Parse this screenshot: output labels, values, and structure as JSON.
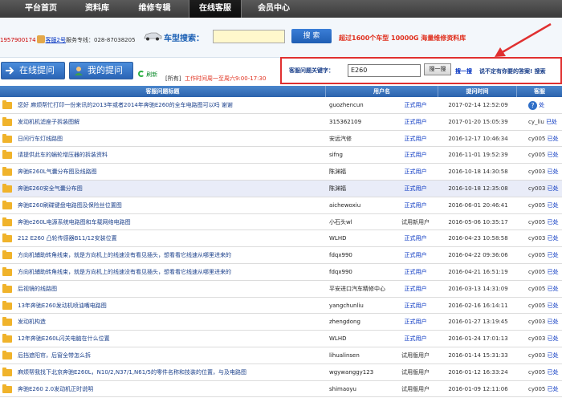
{
  "nav": {
    "items": [
      {
        "label": "平台首页",
        "active": false
      },
      {
        "label": "资料库",
        "active": false
      },
      {
        "label": "维修专辑",
        "active": false
      },
      {
        "label": "在线客服",
        "active": true
      },
      {
        "label": "会员中心",
        "active": false
      }
    ]
  },
  "header": {
    "service_code": "1957900174",
    "service_link": "客服2号",
    "service_phone": "服务专线：028-87038205",
    "car_search_label": "车型搜索：",
    "car_search_button": "搜 索",
    "ad_text": "超过1600个车型  10000G 海量维修资料库"
  },
  "toolbar": {
    "online_question": "在线提问",
    "my_question": "我的提问",
    "refresh": "刷新",
    "filter": "[所有]",
    "work_time": "工作时间周一至周六9:00-17:30"
  },
  "keyword_search": {
    "label": "客服问题关键字：",
    "value": "E260",
    "button": "搜一搜",
    "link": "搜一搜",
    "hint": "说不定有你要的答案! 搜索"
  },
  "table": {
    "headers": [
      "客服问题标题",
      "用户名",
      "提问时间",
      "客服"
    ],
    "rows": [
      {
        "title": "您好  麻烦帮忙打印一份来讯的2013年或者2014年奔驰E260的全车电路图可以吗  谢谢",
        "user": "guozhencun",
        "type": "正式用户",
        "time": "2017-02-14 12:52:09",
        "status_user": "",
        "status": "处",
        "help": true,
        "hl": false
      },
      {
        "title": "发动机机滤座子拆装图解",
        "user": "315362109",
        "type": "正式用户",
        "time": "2017-01-20 15:05:39",
        "status_user": "cy_liu",
        "status": "已处",
        "help": false,
        "hl": false
      },
      {
        "title": "日间行车灯线路图",
        "user": "安远汽修",
        "type": "正式用户",
        "time": "2016-12-17 10:46:34",
        "status_user": "cy005",
        "status": "已处",
        "help": false,
        "hl": false
      },
      {
        "title": "请提供此车的蜗轮增压器的拆装资料",
        "user": "sifng",
        "type": "正式用户",
        "time": "2016-11-01 19:52:39",
        "status_user": "cy005",
        "status": "已处",
        "help": false,
        "hl": false
      },
      {
        "title": "奔驰E260L气囊分布图及线路图",
        "user": "陈渊福",
        "type": "正式用户",
        "time": "2016-10-18 14:30:58",
        "status_user": "cy003",
        "status": "已处",
        "help": false,
        "hl": false
      },
      {
        "title": "奔驰E260安全气囊分布图",
        "user": "陈渊福",
        "type": "正式用户",
        "time": "2016-10-18 12:35:08",
        "status_user": "cy003",
        "status": "已处",
        "help": false,
        "hl": true
      },
      {
        "title": "奔驰E260刷碟键盘电路图及保险丝位置图",
        "user": "aichewoxiu",
        "type": "正式用户",
        "time": "2016-06-01 20:46:41",
        "status_user": "cy005",
        "status": "已处",
        "help": false,
        "hl": false
      },
      {
        "title": "奔驰e260L电源系统电路图和车载网络电路图",
        "user": "小石头wl",
        "type": "试用新用户",
        "time": "2016-05-06 10:35:17",
        "status_user": "cy005",
        "status": "已处",
        "help": false,
        "hl": false
      },
      {
        "title": "212 E260 凸轮传感器B11/12安装位置",
        "user": "WLHD",
        "type": "正式用户",
        "time": "2016-04-23 10:58:58",
        "status_user": "cy003",
        "status": "已处",
        "help": false,
        "hl": false
      },
      {
        "title": "方向机辅助转角线束，就是方向机上的线速没有看见插头，想看看它线速从哪里进来的",
        "user": "fdqx990",
        "type": "正式用户",
        "time": "2016-04-22 09:36:06",
        "status_user": "cy005",
        "status": "已处",
        "help": false,
        "hl": false
      },
      {
        "title": "方向机辅助转角线束，就是方向机上的线速没有看见插头，想看看它线速从哪里进来的",
        "user": "fdqx990",
        "type": "正式用户",
        "time": "2016-04-21 16:51:19",
        "status_user": "cy005",
        "status": "已处",
        "help": false,
        "hl": false
      },
      {
        "title": "后视镜的线路图",
        "user": "平安进口汽车精修中心",
        "type": "正式用户",
        "time": "2016-03-13 14:31:09",
        "status_user": "cy005",
        "status": "已处",
        "help": false,
        "hl": false
      },
      {
        "title": "13年奔驰E260发动机喷油嘴电路图",
        "user": "yangchunliu",
        "type": "正式用户",
        "time": "2016-02-16 16:14:11",
        "status_user": "cy005",
        "status": "已处",
        "help": false,
        "hl": false
      },
      {
        "title": "发动机构造",
        "user": "zhengdong",
        "type": "正式用户",
        "time": "2016-01-27 13:19:45",
        "status_user": "cy003",
        "status": "已处",
        "help": false,
        "hl": false
      },
      {
        "title": "12年奔驰E260L闪关电脑在什么位置",
        "user": "WLHD",
        "type": "正式用户",
        "time": "2016-01-24 17:01:13",
        "status_user": "cy003",
        "status": "已处",
        "help": false,
        "hl": false
      },
      {
        "title": "后挡遮阳帘，后窗全带怎么拆",
        "user": "lihualinsen",
        "type": "试用版用户",
        "time": "2016-01-14 15:31:33",
        "status_user": "cy003",
        "status": "已处",
        "help": false,
        "hl": false
      },
      {
        "title": "麻烦帮我找下北京奔驰E260L，N10/2,N37/1,N61/5的零件名称和技装的位置，与及电路图",
        "user": "wgywanggy123",
        "type": "试用版用户",
        "time": "2016-01-12 16:33:24",
        "status_user": "cy005",
        "status": "已处",
        "help": false,
        "hl": false
      },
      {
        "title": "奔驰E260 2.0发动机正时说明",
        "user": "shimaoyu",
        "type": "试用版用户",
        "time": "2016-01-09 12:11:06",
        "status_user": "cy005",
        "status": "已处",
        "help": false,
        "hl": false
      }
    ]
  },
  "colors": {
    "nav_bg": "#3a3a3a",
    "header_blue": "#2c63ad",
    "accent_red": "#e0301e",
    "link_blue": "#0030c0",
    "folder": "#f0b32b"
  }
}
